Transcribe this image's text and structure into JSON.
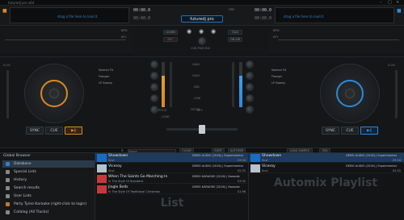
{
  "window": {
    "title": "futuredj pro x64"
  },
  "deck_left": {
    "wave_hint": "drag a file here to load it",
    "time": "00:00.0",
    "remaining": "00:00.0",
    "bpm_label": "BPM",
    "key_label": "KEY",
    "pitch_value": "0.0%",
    "fx": [
      "Normal FX",
      "Flanger",
      "LP Sweep"
    ],
    "buttons": {
      "sync": "SYNC",
      "cue": "CUE",
      "play": "▶‖"
    }
  },
  "deck_right": {
    "wave_hint": "drag a file here to load it",
    "time": "00:00.0",
    "remaining": "00:00.0",
    "bpm_label": "BPM",
    "key_label": "KEY",
    "pitch_value": "0.0%",
    "fx": [
      "Normal FX",
      "Flanger",
      "LP Sweep"
    ],
    "buttons": {
      "sync": "SYNC",
      "cue": "CUE",
      "play": "▶‖"
    }
  },
  "center": {
    "logo": "futuredj pro",
    "cpu": "CPU",
    "learn": "LEARN",
    "rec": "REC",
    "cue_mix": "CUE-PGM MIX",
    "talk": "TALK",
    "on_air": "ON AIR",
    "labels": [
      "GAIN",
      "HIGH",
      "MID",
      "LOW",
      "FILTER"
    ],
    "pitch_label": "PITCH",
    "key_mid": "KEY",
    "load_label": "LOAD"
  },
  "toolbar": {
    "search_placeholder": "Search",
    "clear": "CLEAR",
    "sort": "SORT",
    "automix": "AUTOMIX",
    "load_sample": "LOAD SAMPLE",
    "tag": "TAG"
  },
  "sidebar": {
    "title": "Global Browser",
    "items": [
      {
        "label": "Database",
        "icon": "database-icon",
        "color": "#3a7fc2"
      },
      {
        "label": "Special Lists",
        "icon": "star-icon",
        "color": "#888888"
      },
      {
        "label": "History",
        "icon": "clock-icon",
        "color": "#888888"
      },
      {
        "label": "Search results",
        "icon": "search-icon",
        "color": "#888888"
      },
      {
        "label": "User Lists",
        "icon": "list-icon",
        "color": "#888888"
      },
      {
        "label": "Party Tyme Karaoke (right-click to login)",
        "icon": "karaoke-icon",
        "color": "#c07a30"
      },
      {
        "label": "Catalog (All Tracks)",
        "icon": "catalog-icon",
        "color": "#888888"
      }
    ]
  },
  "tracks_main": [
    {
      "title": "Showdown",
      "artist": "Suvi",
      "album": "DEMO AUDIO (2016) | Experimental",
      "duration": "03:34",
      "thumb": "#1a6bc4",
      "selected": true
    },
    {
      "title": "Viceroy",
      "artist": "Suvi",
      "album": "DEMO AUDIO (2016) | Experimental",
      "duration": "02:31",
      "thumb": "#b9c2ca",
      "selected": false
    },
    {
      "title": "When The Saints Go Marching In",
      "artist": "In The Style Of Standard",
      "album": "DEMO KARAOKE (2016) | Karaoke",
      "duration": "03:32",
      "thumb": "#c43a3a",
      "selected": false
    },
    {
      "title": "Jingle Bells",
      "artist": "In The Style Of Traditional Christmas",
      "album": "DEMO KARAOKE (2016) | Karaoke",
      "duration": "01:56",
      "thumb": "#c43a3a",
      "selected": false
    }
  ],
  "tracks_automix": [
    {
      "title": "Showdown",
      "artist": "Suvi",
      "album": "DEMO AUDIO (2016) | Experimental",
      "duration": "03:34",
      "thumb": "#1a6bc4",
      "selected": true
    },
    {
      "title": "Viceroy",
      "artist": "Suvi",
      "album": "DEMO AUDIO (2016) | Experimental",
      "duration": "02:31",
      "thumb": "#b9c2ca",
      "selected": false
    }
  ],
  "watermarks": {
    "list": "List",
    "automix": "Automix Playlist"
  },
  "colors": {
    "accent_left": "#d98a20",
    "accent_right": "#2e8ad8",
    "selection": "#1e3a5c"
  }
}
